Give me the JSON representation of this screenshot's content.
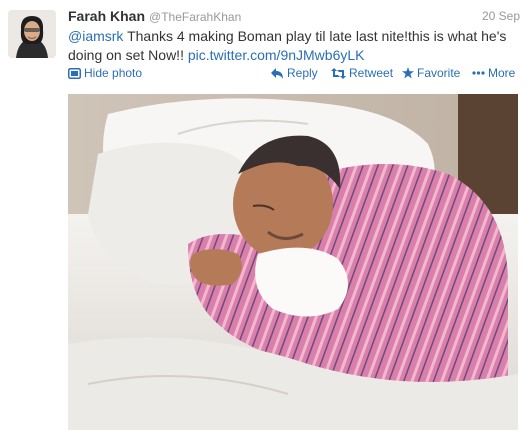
{
  "tweet": {
    "author_name": "Farah Khan",
    "author_handle": "@TheFarahKhan",
    "date": "20 Sep",
    "mention": "@iamsrk",
    "body": " Thanks 4 making Boman play til late last nite!this is what he's doing on set Now!! ",
    "link": "pic.twitter.com/9nJMwb6yLK"
  },
  "actions": {
    "hide_photo": "Hide photo",
    "reply": "Reply",
    "retweet": "Retweet",
    "favorite": "Favorite",
    "more": "More"
  },
  "colors": {
    "link": "#2a6fb6",
    "muted": "#999999",
    "text": "#333333"
  }
}
